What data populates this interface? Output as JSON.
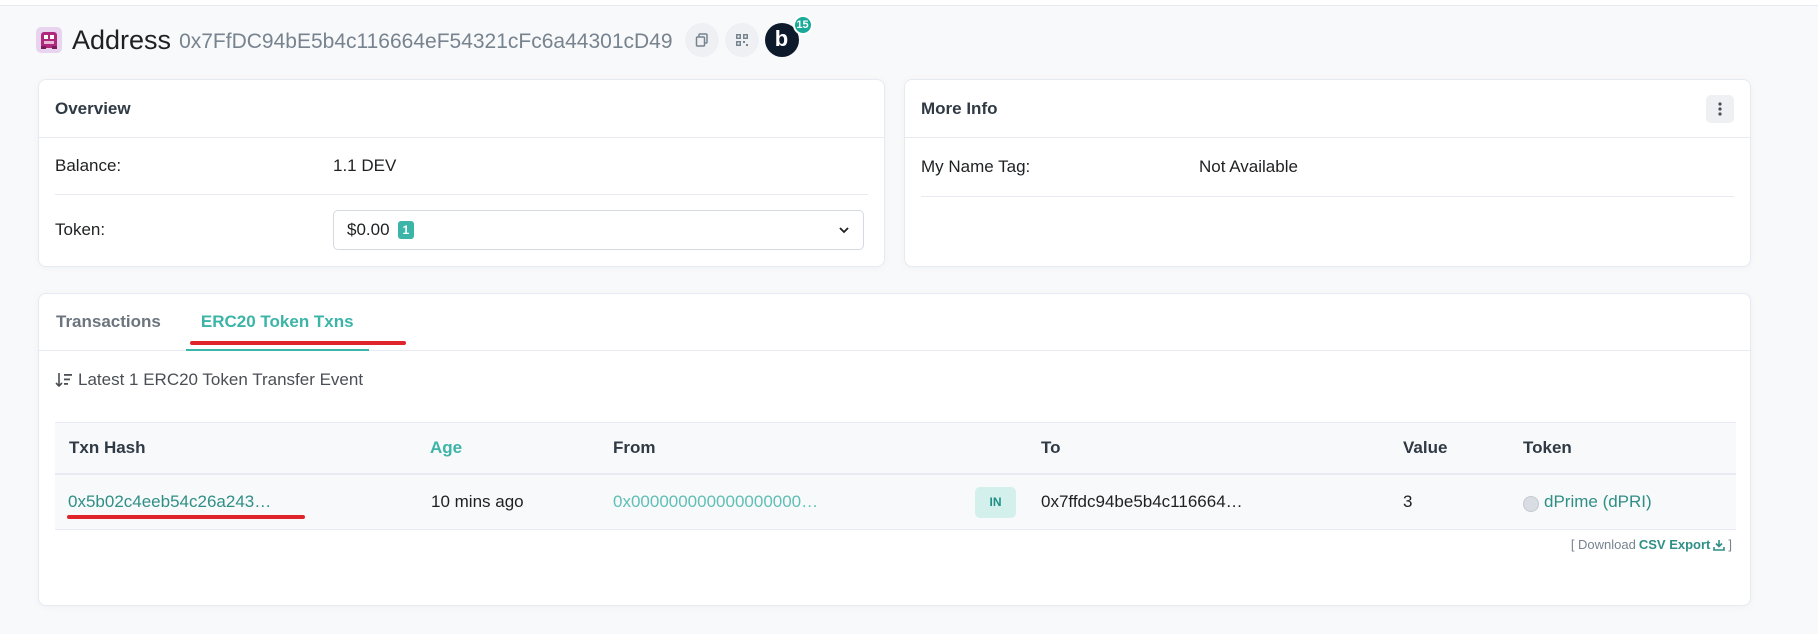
{
  "header": {
    "title": "Address",
    "address": "0x7FfDC94bE5b4c116664eF54321cFc6a44301cD49",
    "blockscan_badge_count": "15",
    "icons": [
      "avatar-icon",
      "copy-icon",
      "qr-code-icon",
      "blockscan-icon"
    ]
  },
  "overview": {
    "title": "Overview",
    "balance_label": "Balance:",
    "balance_value": "1.1 DEV",
    "token_label": "Token:",
    "token_value": "$0.00",
    "token_count": "1"
  },
  "more_info": {
    "title": "More Info",
    "name_tag_label": "My Name Tag:",
    "name_tag_value": "Not Available"
  },
  "tabs": [
    {
      "label": "Transactions",
      "active": false
    },
    {
      "label": "ERC20 Token Txns",
      "active": true
    }
  ],
  "txns": {
    "summary": "Latest 1 ERC20 Token Transfer Event",
    "columns": [
      "Txn Hash",
      "Age",
      "From",
      "",
      "To",
      "Value",
      "Token"
    ],
    "rows": [
      {
        "txn_hash": "0x5b02c4eeb54c26a243…",
        "age": "10 mins ago",
        "from": "0x000000000000000000…",
        "direction": "IN",
        "to": "0x7ffdc94be5b4c116664…",
        "value": "3",
        "token": "dPrime (dPRI)"
      }
    ],
    "download_prefix": "[ Download",
    "download_link": "CSV Export",
    "download_suffix": "]"
  },
  "colors": {
    "accent": "#3cb4a8",
    "annotation_red": "#e0242c"
  }
}
